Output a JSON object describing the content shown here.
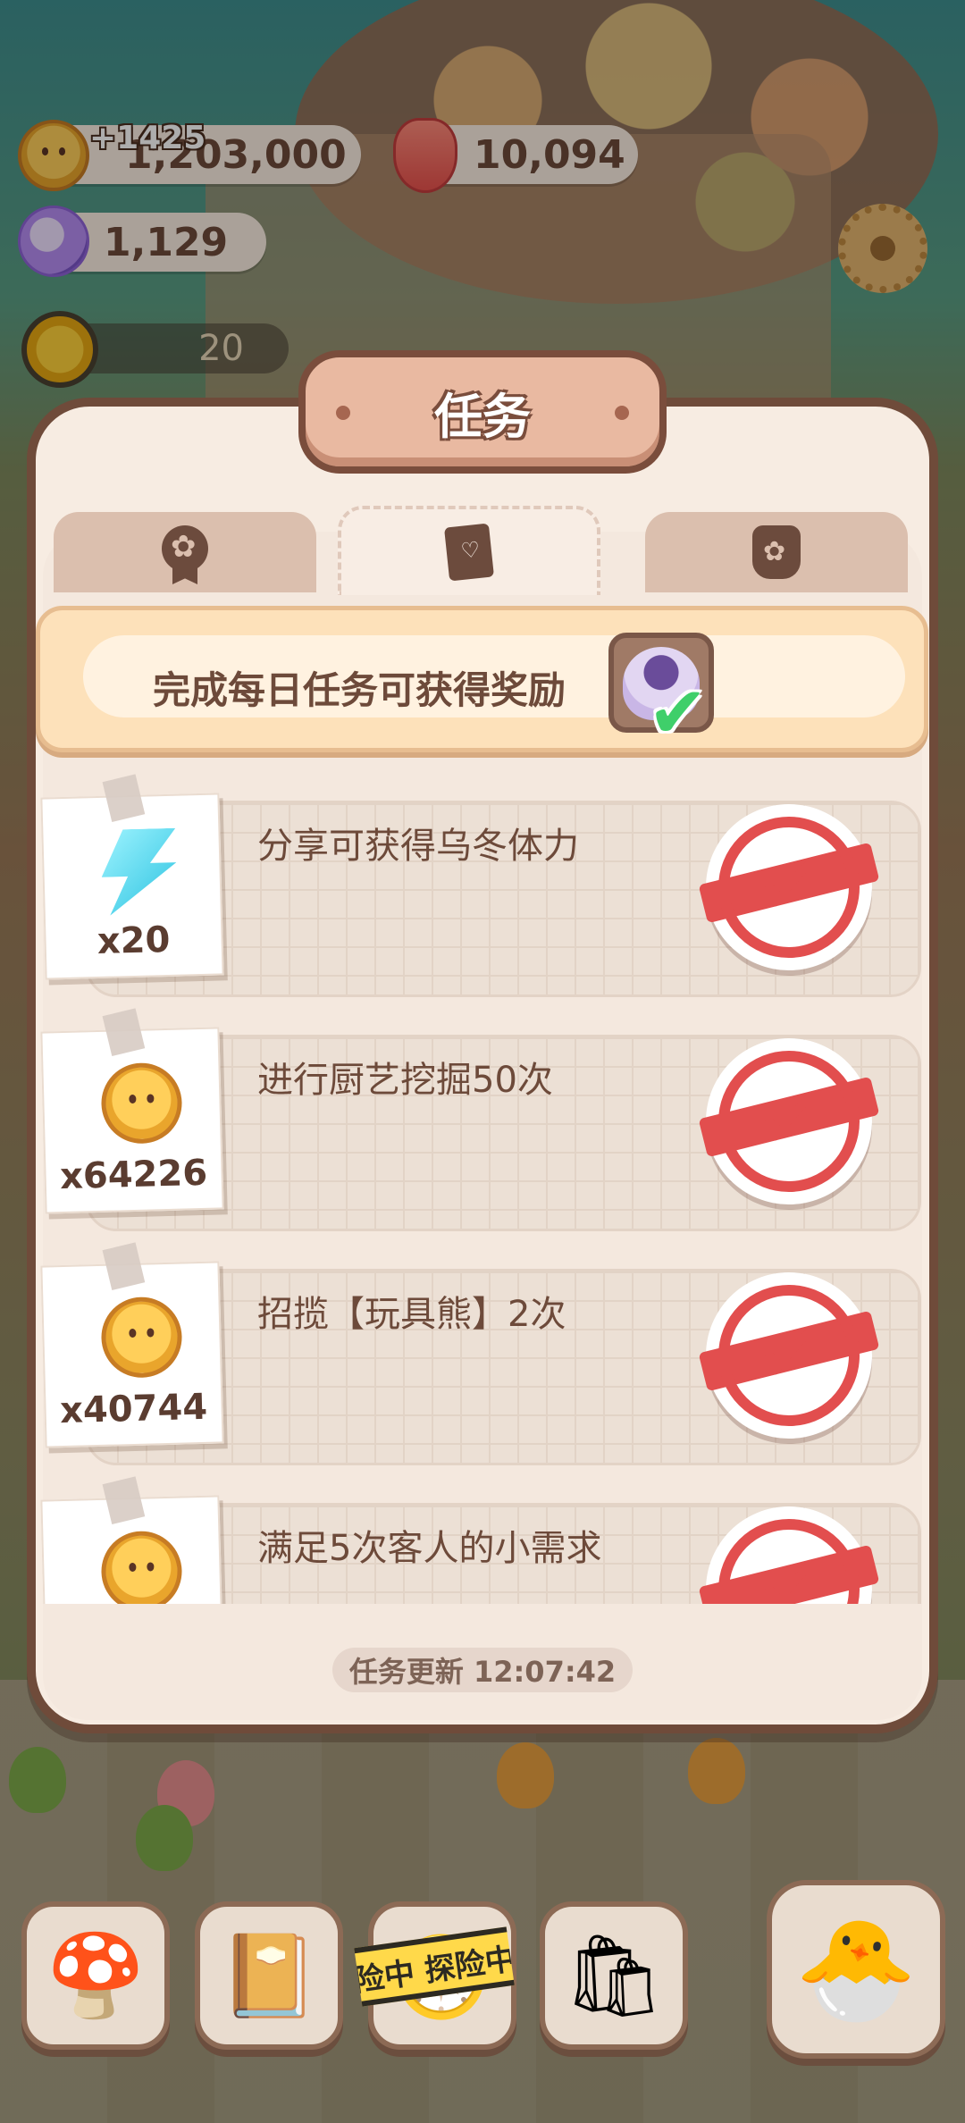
{
  "currencies": {
    "coins": "1,203,000",
    "coin_gain": "+1425",
    "gems": "10,094",
    "crystals": "1,129",
    "energy_counter": "20"
  },
  "panel": {
    "title": "任务",
    "tabs": [
      {
        "icon": "medal-icon",
        "active": false
      },
      {
        "icon": "note-icon",
        "active": true
      },
      {
        "icon": "bottle-icon",
        "active": false
      }
    ],
    "banner_text": "完成每日任务可获得奖励",
    "tasks": [
      {
        "title": "分享可获得乌冬体力",
        "reward_icon": "energy-bolt-icon",
        "reward": "x20",
        "status": "completed"
      },
      {
        "title": "进行厨艺挖掘50次",
        "reward_icon": "cookie-coin-icon",
        "reward": "x64226",
        "status": "completed"
      },
      {
        "title": "招揽【玩具熊】2次",
        "reward_icon": "cookie-coin-icon",
        "reward": "x40744",
        "status": "completed"
      },
      {
        "title": "满足5次客人的小需求",
        "reward_icon": "cookie-coin-icon",
        "reward": "",
        "status": "completed"
      }
    ],
    "refresh_text": "任务更新 12:07:42"
  },
  "bottom_nav": {
    "explore_label": "险中 探险中"
  },
  "colors": {
    "panel_border": "#6f4b3a",
    "stamp_red": "#e24e4e",
    "check_green": "#3fcf6a"
  }
}
